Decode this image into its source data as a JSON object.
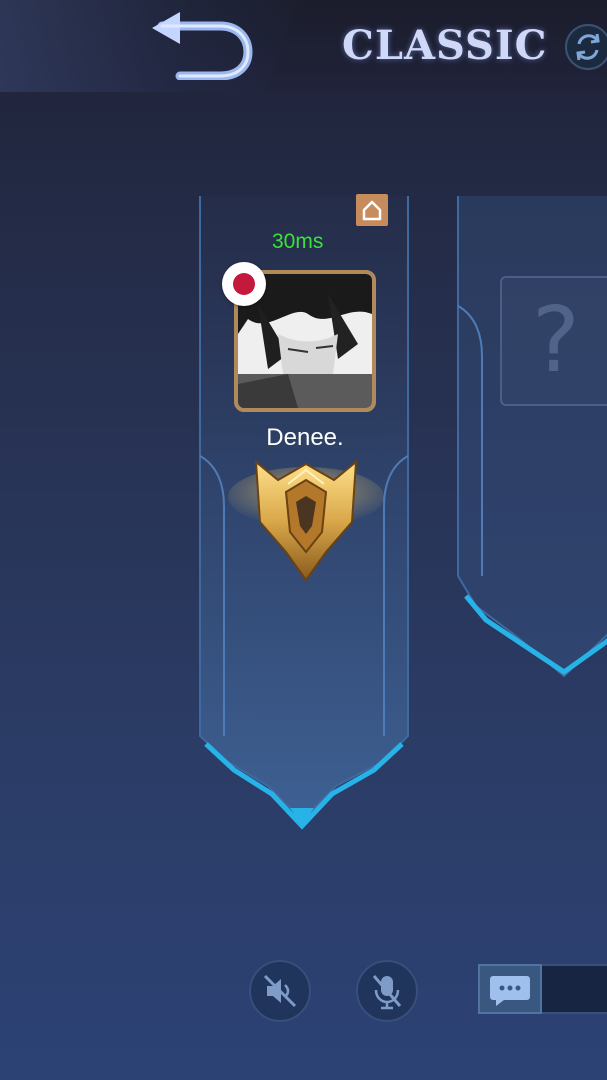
{
  "header": {
    "back_icon": "back-arrow-icon",
    "mode_title": "CLASSIC",
    "refresh_icon": "refresh-icon"
  },
  "player": {
    "ping": "30ms",
    "name": "Denee.",
    "home_icon": "home-icon",
    "flag_icon": "japan-flag-icon",
    "rank_icon": "gold-rank-emblem-icon"
  },
  "empty_slot": {
    "placeholder": "?"
  },
  "bottom_controls": {
    "speaker_icon": "speaker-muted-icon",
    "mic_icon": "microphone-muted-icon",
    "chat_icon": "chat-bubble-icon"
  },
  "colors": {
    "ping_green": "#38e338",
    "accent_cyan": "#27b3e8",
    "gold": "#d9a84a"
  }
}
